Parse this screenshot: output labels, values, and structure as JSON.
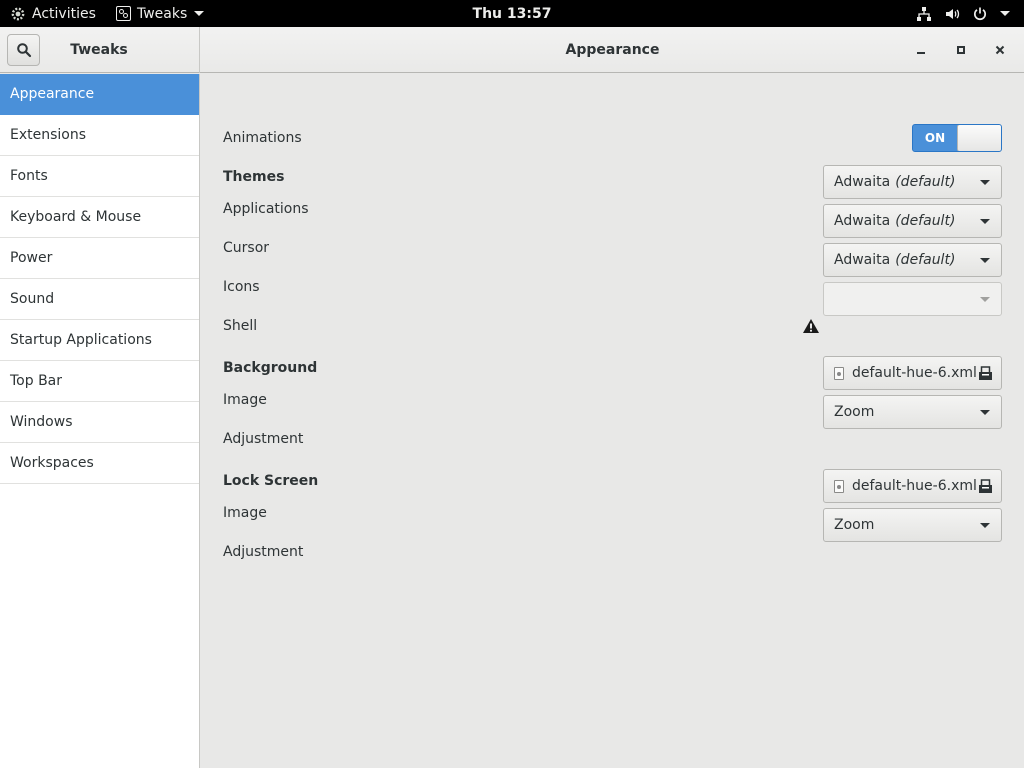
{
  "topbar": {
    "activities": "Activities",
    "app_menu": "Tweaks",
    "clock": "Thu 13:57"
  },
  "window": {
    "app_title": "Tweaks",
    "page_title": "Appearance"
  },
  "sidebar": {
    "items": [
      {
        "label": "Appearance",
        "active": true
      },
      {
        "label": "Extensions"
      },
      {
        "label": "Fonts"
      },
      {
        "label": "Keyboard & Mouse"
      },
      {
        "label": "Power"
      },
      {
        "label": "Sound"
      },
      {
        "label": "Startup Applications"
      },
      {
        "label": "Top Bar"
      },
      {
        "label": "Windows"
      },
      {
        "label": "Workspaces"
      }
    ]
  },
  "appearance": {
    "animations": {
      "label": "Animations",
      "switch_label": "ON",
      "state": "on"
    },
    "themes": {
      "heading": "Themes",
      "applications": {
        "label": "Applications",
        "value": "Adwaita",
        "default_tag": "(default)"
      },
      "cursor": {
        "label": "Cursor",
        "value": "Adwaita",
        "default_tag": "(default)"
      },
      "icons": {
        "label": "Icons",
        "value": "Adwaita",
        "default_tag": "(default)"
      },
      "shell": {
        "label": "Shell",
        "value": ""
      }
    },
    "background": {
      "heading": "Background",
      "image": {
        "label": "Image",
        "value": "default-hue-6.xml"
      },
      "adjustment": {
        "label": "Adjustment",
        "value": "Zoom"
      }
    },
    "lock_screen": {
      "heading": "Lock Screen",
      "image": {
        "label": "Image",
        "value": "default-hue-6.xml"
      },
      "adjustment": {
        "label": "Adjustment",
        "value": "Zoom"
      }
    }
  },
  "colors": {
    "accent": "#4a90d9",
    "topbar_bg": "#000000",
    "window_bg": "#e8e8e7"
  }
}
